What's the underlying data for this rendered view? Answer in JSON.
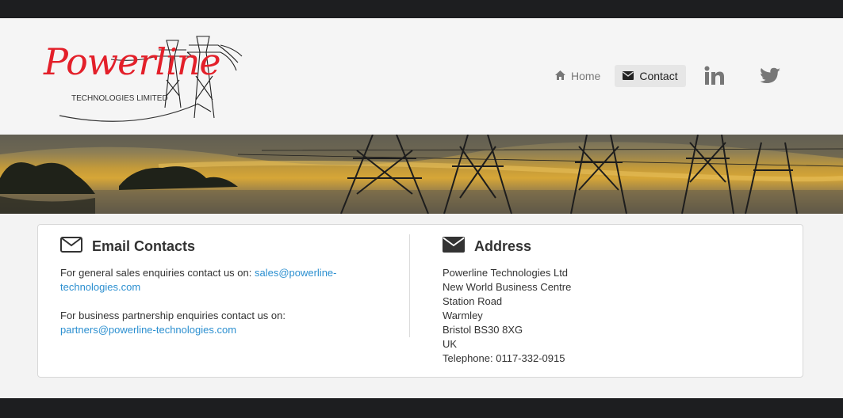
{
  "logo": {
    "title": "Powerline",
    "subtitle": "TECHNOLOGIES LIMITED"
  },
  "nav": {
    "home_label": "Home",
    "contact_label": "Contact",
    "home_icon": "home-icon",
    "contact_icon": "envelope-icon"
  },
  "social": {
    "linkedin_icon": "linkedin-icon",
    "twitter_icon": "twitter-icon"
  },
  "email_contacts": {
    "heading": "Email Contacts",
    "sales_text": "For general sales enquiries contact us on: ",
    "sales_email": "sales@powerline-technologies.com",
    "partners_text": "For business partnership enquiries contact us on:",
    "partners_email": "partners@powerline-technologies.com"
  },
  "address": {
    "heading": "Address",
    "lines": [
      "Powerline Technologies Ltd",
      "New World Business Centre",
      "Station Road",
      "Warmley",
      "Bristol BS30 8XG",
      "UK",
      "Telephone: 0117-332-0915"
    ]
  },
  "colors": {
    "brand_red": "#e3202a",
    "link_blue": "#2b8fd0",
    "dark_bar": "#1d1e20"
  }
}
